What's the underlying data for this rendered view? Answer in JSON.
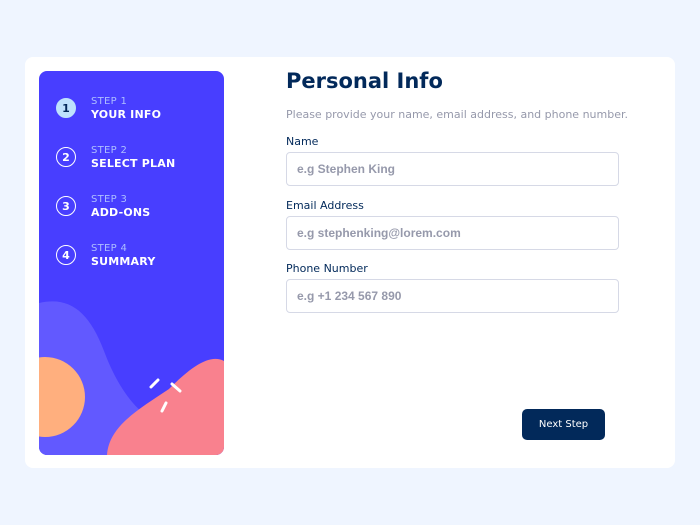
{
  "sidebar": {
    "steps": [
      {
        "number": "1",
        "caption": "STEP 1",
        "title": "YOUR INFO",
        "active": true
      },
      {
        "number": "2",
        "caption": "STEP 2",
        "title": "SELECT PLAN",
        "active": false
      },
      {
        "number": "3",
        "caption": "STEP 3",
        "title": "ADD-ONS",
        "active": false
      },
      {
        "number": "4",
        "caption": "STEP 4",
        "title": "SUMMARY",
        "active": false
      }
    ]
  },
  "form": {
    "title": "Personal Info",
    "subtitle": "Please provide your name, email address, and phone number.",
    "fields": [
      {
        "label": "Name",
        "value": "",
        "placeholder": "e.g Stephen King"
      },
      {
        "label": "Email Address",
        "value": "",
        "placeholder": "e.g stephenking@lorem.com"
      },
      {
        "label": "Phone Number",
        "value": "",
        "placeholder": "e.g +1 234 567 890"
      }
    ],
    "next_label": "Next Step"
  },
  "colors": {
    "page_bg": "#eff5ff",
    "sidebar_bg": "#483eff",
    "active_step_bg": "#bee2fd",
    "navy": "#02295a",
    "gray": "#9699ab",
    "border": "#d6d9e6",
    "blob_purple": "#6259ff",
    "blob_orange": "#ffaf7e",
    "blob_pink": "#f9818e"
  }
}
